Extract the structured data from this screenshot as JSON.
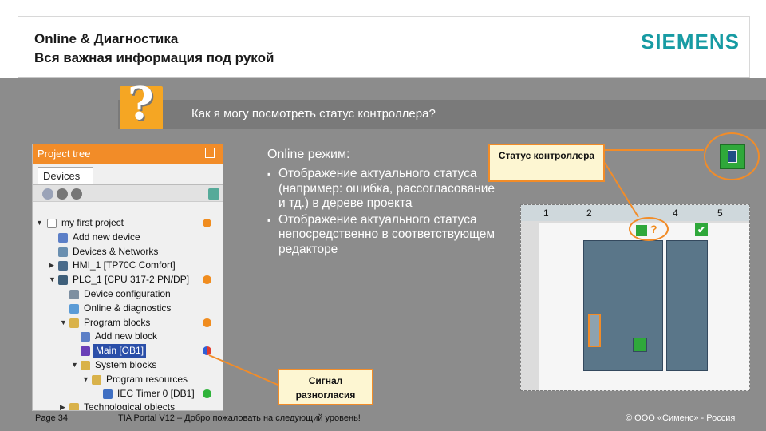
{
  "header": {
    "line1": "Online & Диагностика",
    "line2": "Вся важная информация под рукой",
    "brand": "SIEMENS"
  },
  "question": {
    "icon_glyph": "?",
    "text": "Как я могу посмотреть статус контроллера?"
  },
  "project_tree": {
    "title": "Project tree",
    "tab": "Devices",
    "items": [
      {
        "label": "my first project",
        "status": "warning"
      },
      {
        "label": "Add new device"
      },
      {
        "label": "Devices & Networks"
      },
      {
        "label": "HMI_1 [TP70C Comfort]"
      },
      {
        "label": "PLC_1 [CPU 317-2 PN/DP]",
        "status": "warning"
      },
      {
        "label": "Device configuration"
      },
      {
        "label": "Online & diagnostics"
      },
      {
        "label": "Program blocks",
        "status": "warning"
      },
      {
        "label": "Add new block"
      },
      {
        "label": "Main [OB1]",
        "status": "mismatch"
      },
      {
        "label": "System blocks"
      },
      {
        "label": "Program resources"
      },
      {
        "label": "IEC Timer 0 [DB1]",
        "status": "ok"
      },
      {
        "label": "Technological objects"
      }
    ]
  },
  "online_mode": {
    "heading": "Online режим:",
    "bullets": [
      "Отображение актуального статуса (например: ошибка, рассогласование и тд.) в дереве проекта",
      "Отображение актуального статуса непосредственно в соответствующем редакторе"
    ]
  },
  "callouts": {
    "status": "Статус контроллера",
    "mismatch": "Сигнал разногласия"
  },
  "editor": {
    "slots": [
      "1",
      "2",
      "4",
      "5"
    ],
    "ok_glyph": "✔",
    "question_glyph": "?"
  },
  "footer": {
    "page": "Page 34",
    "title": "TIA Portal V12 – Добро пожаловать на следующий уровень!",
    "copyright": "© ООО «Сименс» - Россия"
  },
  "colors": {
    "accent_orange": "#f28c28",
    "brand_teal": "#179ba3",
    "status_ok": "#2fa83a"
  }
}
